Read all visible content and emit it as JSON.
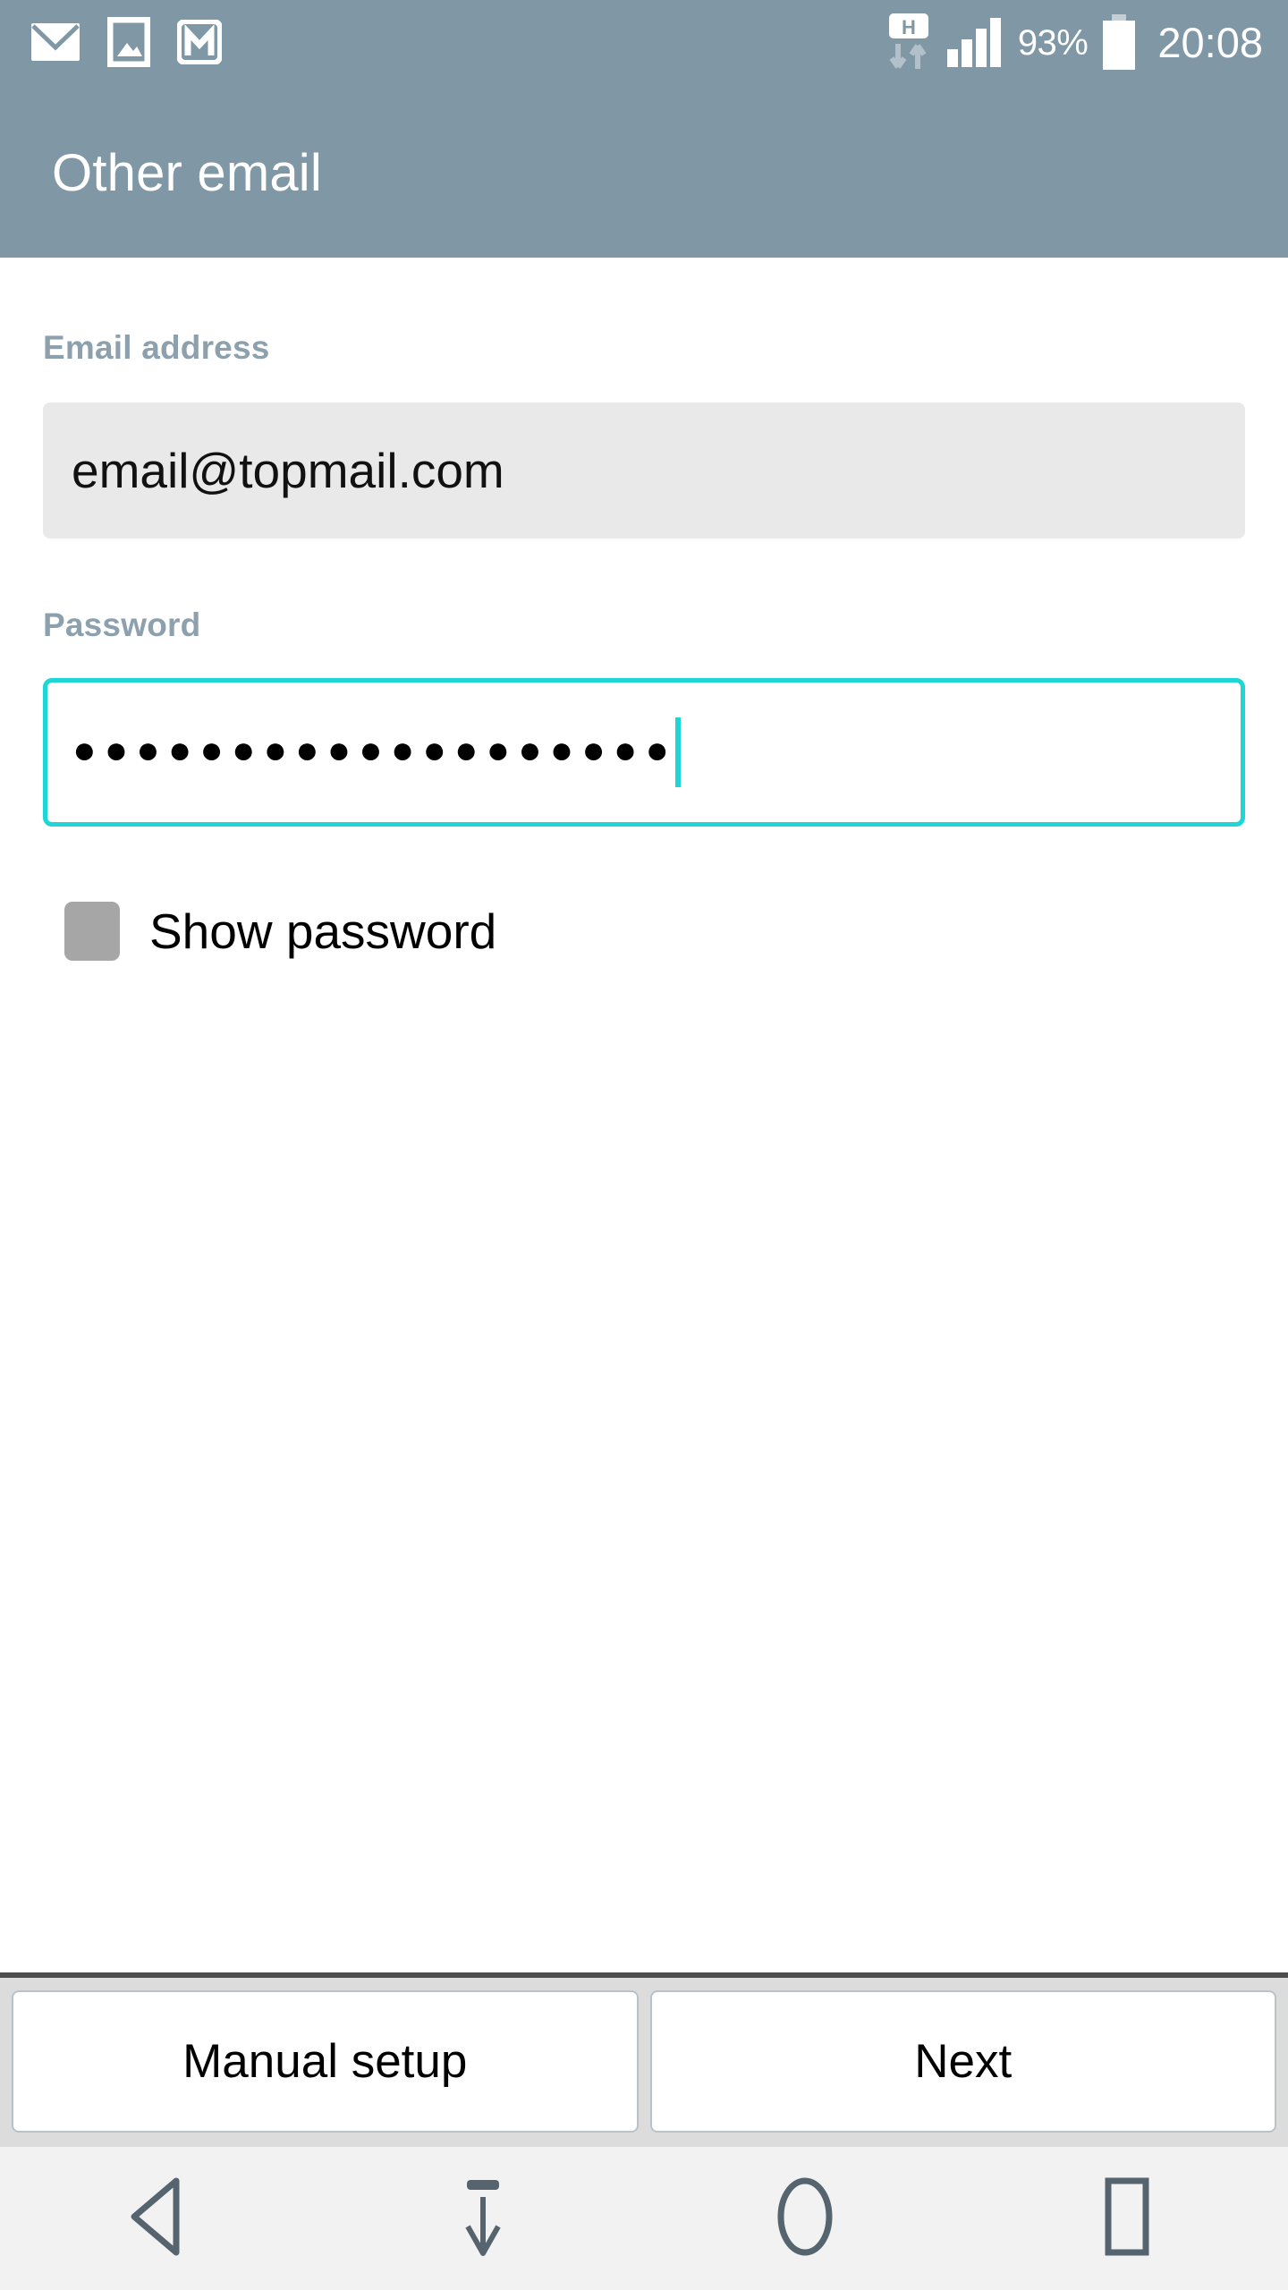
{
  "statusbar": {
    "icons_left": [
      "envelope-icon",
      "photo-icon",
      "gmail-icon"
    ],
    "network_type": "H",
    "network_icon": "hsdpa-data-transfer-icon",
    "signal_icon": "signal-bars-icon",
    "battery_percent": "93%",
    "battery_icon": "battery-icon",
    "clock": "20:08",
    "background_color": "#8097a6",
    "text_color": "#ffffff"
  },
  "titlebar": {
    "title": "Other email",
    "background_color": "#8097a6"
  },
  "form": {
    "email": {
      "label": "Email address",
      "value": "email@topmail.com",
      "placeholder": "Email address",
      "field_background": "#e9e9e9"
    },
    "password": {
      "label": "Password",
      "value": "●●●●●●●●●●●●●●●●●●●",
      "placeholder": "Password",
      "focus_border_color": "#1fd6d6",
      "focused": true,
      "character_count": 19
    },
    "show_password": {
      "label": "Show password",
      "checked": false,
      "checkbox_color": "#a6a6a6"
    },
    "label_color": "#8da0ae"
  },
  "buttonbar": {
    "manual_setup_label": "Manual setup",
    "next_label": "Next",
    "background_color": "#dcdcdc"
  },
  "navbar": {
    "buttons": [
      {
        "name": "back-icon",
        "label": "Back"
      },
      {
        "name": "hide-keyboard-icon",
        "label": "Hide keyboard"
      },
      {
        "name": "home-icon",
        "label": "Home"
      },
      {
        "name": "recents-icon",
        "label": "Recent apps"
      }
    ],
    "icon_color": "#55646e",
    "background_color": "#f2f2f2"
  }
}
